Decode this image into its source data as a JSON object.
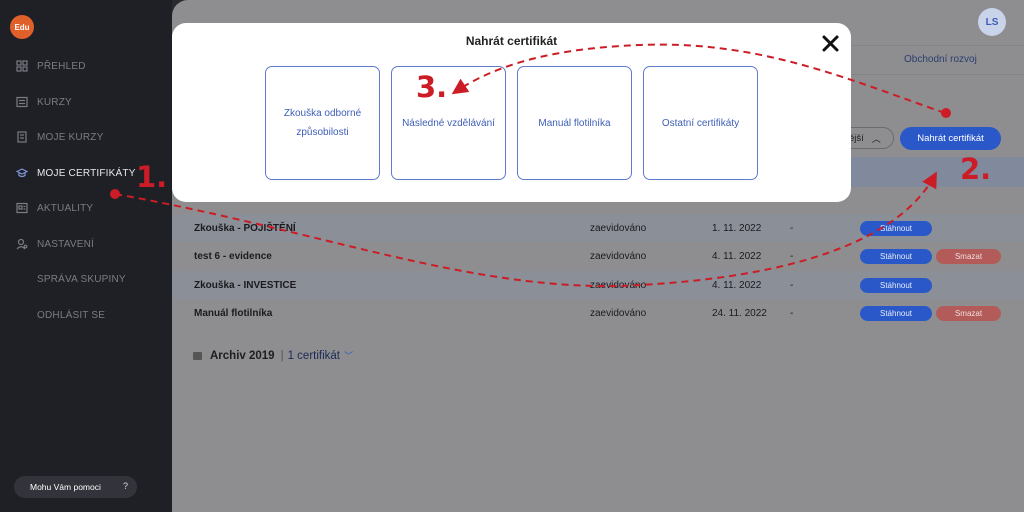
{
  "sidebar": {
    "logo": "Edu",
    "items": [
      {
        "label": "PŘEHLED",
        "icon": "grid-icon",
        "active": false
      },
      {
        "label": "KURZY",
        "icon": "list-icon",
        "active": false
      },
      {
        "label": "MOJE KURZY",
        "icon": "file-icon",
        "active": false
      },
      {
        "label": "MOJE CERTIFIKÁTY",
        "icon": "graduation-icon",
        "active": true
      },
      {
        "label": "AKTUALITY",
        "icon": "news-icon",
        "active": false
      },
      {
        "label": "NASTAVENÍ",
        "icon": "user-settings-icon",
        "active": false
      },
      {
        "label": "SPRÁVA SKUPINY",
        "icon": "",
        "active": false
      },
      {
        "label": "ODHLÁSIT SE",
        "icon": "",
        "active": false
      }
    ],
    "help": {
      "label": "Mohu Vám pomoci",
      "icon": "?"
    }
  },
  "header": {
    "avatar_initials": "LS",
    "tab_visible": "Obchodní rozvoj"
  },
  "toolbar": {
    "sort_label": "ější",
    "upload_label": "Nahrát certifikát"
  },
  "table": {
    "rows": [
      {
        "name": "Zkouška - POJIŠTĚNÍ",
        "status": "zaevidováno",
        "date": "1. 11. 2022",
        "dash": "-",
        "download": "Stáhnout",
        "delete": ""
      },
      {
        "name": "test 6 - evidence",
        "status": "zaevidováno",
        "date": "4. 11. 2022",
        "dash": "-",
        "download": "Stáhnout",
        "delete": "Smazat"
      },
      {
        "name": "Zkouška - INVESTICE",
        "status": "zaevidováno",
        "date": "4. 11. 2022",
        "dash": "-",
        "download": "Stáhnout",
        "delete": ""
      },
      {
        "name": "Manuál flotilníka",
        "status": "zaevidováno",
        "date": "24. 11. 2022",
        "dash": "-",
        "download": "Stáhnout",
        "delete": "Smazat"
      }
    ]
  },
  "archive": {
    "title": "Archiv 2019",
    "count": "1 certifikát"
  },
  "modal": {
    "title": "Nahrát certifikát",
    "cards": [
      "Zkouška odborné způsobilosti",
      "Následné vzdělávání",
      "Manuál flotilníka",
      "Ostatní certifikáty"
    ]
  },
  "annotations": {
    "step1": "1.",
    "step2": "2.",
    "step3": "3.",
    "color": "#cc1d26"
  }
}
